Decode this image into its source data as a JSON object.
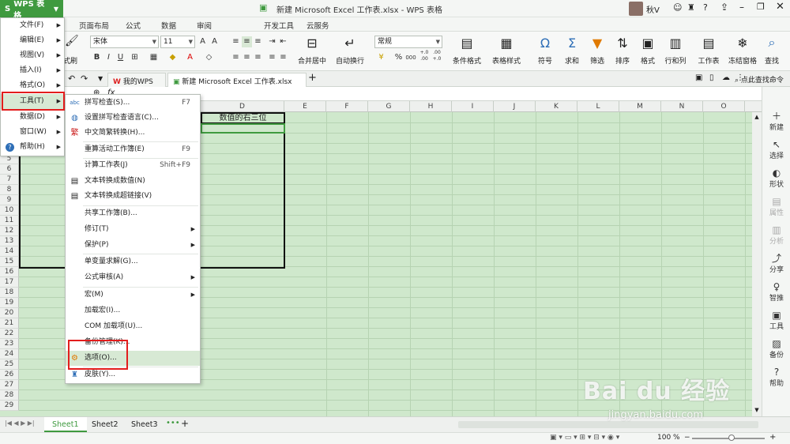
{
  "app": {
    "button_label": "WPS 表格",
    "window_title": "新建 Microsoft Excel 工作表.xlsx - WPS 表格",
    "user_name": "秋V"
  },
  "menu_tabs": [
    "页面布局",
    "公式",
    "数据",
    "审阅",
    "开发工具",
    "云服务"
  ],
  "ribbon": {
    "font_name": "宋体",
    "font_size": "11",
    "number_format": "常规",
    "format_painter_label": "式刷",
    "merge_label": "合并居中",
    "wrap_label": "自动换行",
    "cond_format_label": "条件格式",
    "table_style_label": "表格样式",
    "symbol_label": "符号",
    "sum_label": "求和",
    "filter_label": "筛选",
    "sort_label": "排序",
    "format_label": "格式",
    "rowcol_label": "行和列",
    "sheet_label": "工作表",
    "freeze_label": "冻结窗格",
    "find_label": "查找",
    "percent": "%",
    "comma": "000",
    "dec_inc": "+.0 .00",
    "dec_dec": ".00 +.0"
  },
  "doc_tabs": {
    "wps": "我的WPS",
    "file": "新建 Microsoft Excel 工作表.xlsx",
    "command_search": "点此查找命令"
  },
  "grid": {
    "columns": [
      "D",
      "E",
      "F",
      "G",
      "H",
      "I",
      "J",
      "K",
      "L",
      "M",
      "N",
      "O"
    ],
    "rows": [
      "5",
      "6",
      "7",
      "8",
      "9",
      "10",
      "11",
      "12",
      "13",
      "14",
      "15",
      "16",
      "17",
      "18",
      "19",
      "20",
      "21",
      "22",
      "23",
      "24",
      "25",
      "26",
      "27",
      "28",
      "29"
    ],
    "header_cell": "数值的右三位"
  },
  "main_menu": [
    {
      "label": "文件(F)",
      "has_sub": true
    },
    {
      "label": "编辑(E)",
      "has_sub": true
    },
    {
      "label": "视图(V)",
      "has_sub": true
    },
    {
      "label": "插入(I)",
      "has_sub": true
    },
    {
      "label": "格式(O)",
      "has_sub": true
    },
    {
      "label": "工具(T)",
      "has_sub": true
    },
    {
      "label": "数据(D)",
      "has_sub": true
    },
    {
      "label": "窗口(W)",
      "has_sub": true
    },
    {
      "label": "帮助(H)",
      "has_sub": true
    }
  ],
  "tools_submenu": [
    {
      "label": "拼写检查(S)...",
      "shortcut": "F7",
      "icon": "abc"
    },
    {
      "label": "设置拼写检查语言(C)...",
      "shortcut": "",
      "icon": "globe"
    },
    {
      "label": "中文简繁转换(H)...",
      "shortcut": "",
      "icon": "convert"
    },
    {
      "label": "重算活动工作簿(E)",
      "shortcut": "F9",
      "icon": ""
    },
    {
      "label": "计算工作表(J)",
      "shortcut": "Shift+F9",
      "icon": ""
    },
    {
      "label": "文本转换成数值(N)",
      "shortcut": "",
      "icon": "text-num"
    },
    {
      "label": "文本转换成超链接(V)",
      "shortcut": "",
      "icon": "text-link"
    },
    {
      "label": "共享工作簿(B)...",
      "shortcut": "",
      "icon": ""
    },
    {
      "label": "修订(T)",
      "shortcut": "",
      "icon": "",
      "has_sub": true
    },
    {
      "label": "保护(P)",
      "shortcut": "",
      "icon": "",
      "has_sub": true
    },
    {
      "label": "单变量求解(G)...",
      "shortcut": "",
      "icon": ""
    },
    {
      "label": "公式审核(A)",
      "shortcut": "",
      "icon": "",
      "has_sub": true
    },
    {
      "label": "宏(M)",
      "shortcut": "",
      "icon": "",
      "has_sub": true
    },
    {
      "label": "加载宏(I)...",
      "shortcut": "",
      "icon": ""
    },
    {
      "label": "COM 加载项(U)...",
      "shortcut": "",
      "icon": ""
    },
    {
      "label": "备份管理(K)...",
      "shortcut": "",
      "icon": ""
    },
    {
      "label": "选项(O)...",
      "shortcut": "",
      "icon": "gear"
    },
    {
      "label": "皮肤(Y)...",
      "shortcut": "",
      "icon": "skin"
    }
  ],
  "right_panel": [
    "新建",
    "选择",
    "形状",
    "属性",
    "分析",
    "分享",
    "智推",
    "工具",
    "备份",
    "帮助"
  ],
  "sheets": [
    "Sheet1",
    "Sheet2",
    "Sheet3"
  ],
  "status": {
    "zoom": "100 %"
  },
  "watermark": {
    "text": "Bai du 经验",
    "url": "jingyan.baidu.com"
  },
  "colors": {
    "accent": "#3f9a3f",
    "highlight": "#e31d1d",
    "grid_bg": "#cfe8cc"
  }
}
